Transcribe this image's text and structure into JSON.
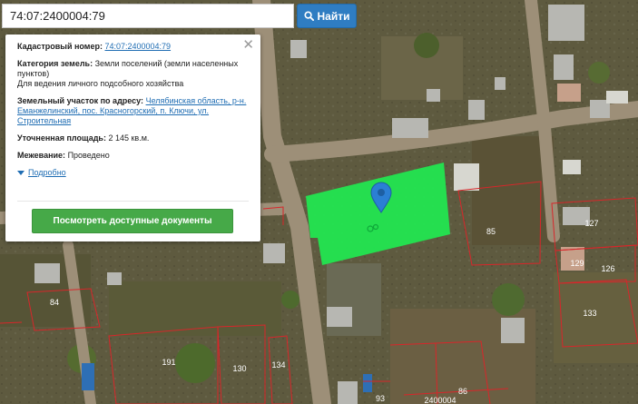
{
  "search": {
    "value": "74:07:2400004:79",
    "button_label": "Найти"
  },
  "popup": {
    "cadastral_label": "Кадастровый номер:",
    "cadastral_value": "74:07:2400004:79",
    "category_label": "Категория земель:",
    "category_value": "Земли поселений (земли населенных пунктов)",
    "category_use": "Для ведения личного подсобного хозяйства",
    "address_label": "Земельный участок по адресу:",
    "address_value": "Челябинская область, р-н. Еманжелинский, пос. Красногорский, п. Ключи, ул. Строительная",
    "area_label": "Уточненная площадь:",
    "area_value": "2 145 кв.м.",
    "survey_label": "Межевание:",
    "survey_value": "Проведено",
    "more_label": "Подробно",
    "docs_button": "Посмотреть доступные документы",
    "close_symbol": "✕"
  },
  "map": {
    "parcel_color": "#22e650",
    "border_color": "#d8262a",
    "marker_color": "#2b7fd4",
    "parcel_numbers": [
      "127",
      "129",
      "126",
      "85",
      "133",
      "84",
      "191",
      "130",
      "134",
      "93",
      "86"
    ],
    "partial_label": "2400004"
  }
}
